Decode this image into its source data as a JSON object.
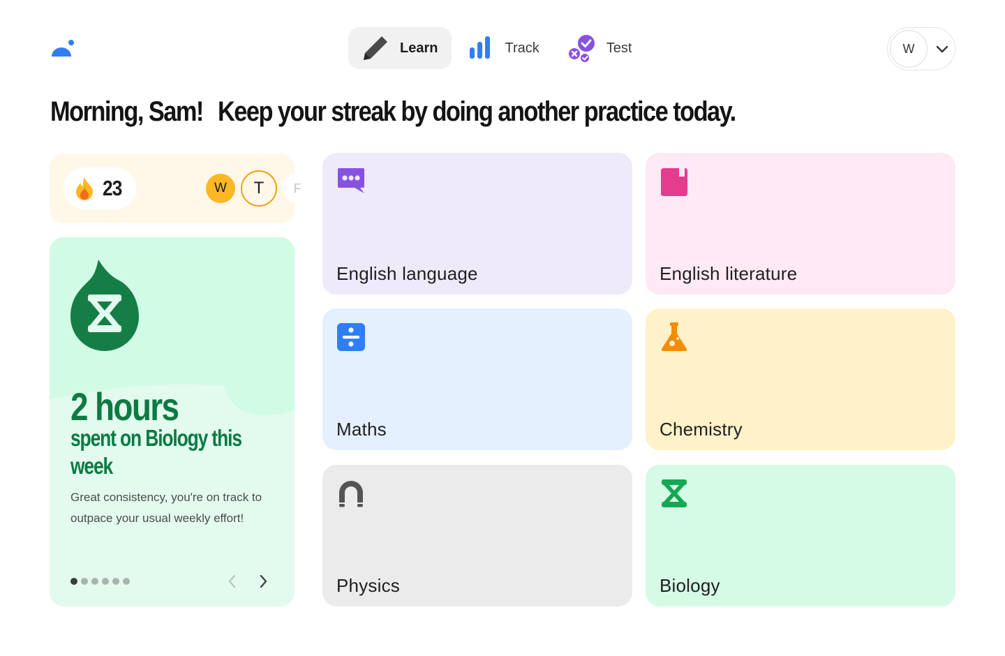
{
  "nav": {
    "items": [
      {
        "label": "Learn",
        "icon": "pencil-icon",
        "active": true
      },
      {
        "label": "Track",
        "icon": "bar-chart-icon",
        "active": false
      },
      {
        "label": "Test",
        "icon": "check-badges-icon",
        "active": false
      }
    ]
  },
  "user": {
    "initial": "W"
  },
  "greeting": {
    "hello": "Morning, Sam!",
    "message": "Keep your streak by doing another practice today."
  },
  "streak": {
    "count": "23",
    "days": [
      {
        "letter": "W",
        "state": "done"
      },
      {
        "letter": "T",
        "state": "today"
      },
      {
        "letter": "F",
        "state": "future"
      }
    ]
  },
  "stat": {
    "big": "2 hours",
    "sub": "spent on Biology this week",
    "desc": "Great consistency, you're on track to outpace your usual weekly effort!",
    "page_index": 1,
    "page_count": 6
  },
  "subjects": [
    {
      "label": "English language",
      "icon": "speech-bubble-icon",
      "bg": "#eeeafa",
      "color": "#8752e0"
    },
    {
      "label": "English literature",
      "icon": "book-icon",
      "bg": "#fee9f4",
      "color": "#e43c8e"
    },
    {
      "label": "Maths",
      "icon": "divide-icon",
      "bg": "#e4f0fd",
      "color": "#2f7ef5"
    },
    {
      "label": "Chemistry",
      "icon": "flask-icon",
      "bg": "#fff1c8",
      "color": "#f48c06"
    },
    {
      "label": "Physics",
      "icon": "magnet-icon",
      "bg": "#ebebeb",
      "color": "#545454"
    },
    {
      "label": "Biology",
      "icon": "dna-icon",
      "bg": "#d5fbe6",
      "color": "#15a852"
    }
  ],
  "colors": {
    "brand": "#2f7ef5",
    "streak_bg": "#fff8e9",
    "stat_bg": "#e2fbee",
    "stat_text": "#0c7a43"
  }
}
